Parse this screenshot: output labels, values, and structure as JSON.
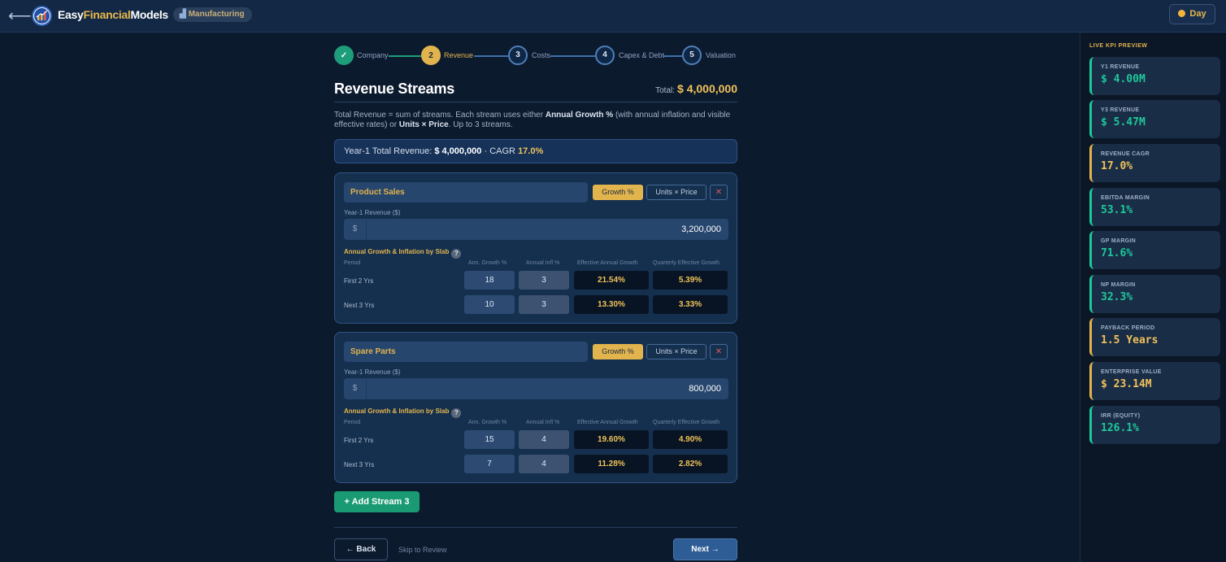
{
  "header": {
    "back_icon": "back-arrow-icon",
    "brand_primary": "Easy",
    "brand_accent": "Financial",
    "brand_suffix": "Models",
    "industry_badge": "Manufacturing",
    "theme_toggle": "Day"
  },
  "stepper": {
    "steps": [
      {
        "number": "✓",
        "label": "Company",
        "state": "done"
      },
      {
        "number": "2",
        "label": "Revenue",
        "state": "active"
      },
      {
        "number": "3",
        "label": "Costs",
        "state": "pending"
      },
      {
        "number": "4",
        "label": "Capex & Debt",
        "state": "pending"
      },
      {
        "number": "5",
        "label": "Valuation",
        "state": "pending"
      }
    ]
  },
  "page": {
    "title": "Revenue Streams",
    "total_label": "Total:",
    "total_value": "$ 4,000,000",
    "description_1": "Total Revenue = sum of streams. Each stream uses either ",
    "description_bold_1": "Annual Growth %",
    "description_2": " (with annual inflation and visible effective rates) or ",
    "description_bold_2": "Units × Price",
    "description_3": ". Up to 3 streams.",
    "summary_prefix": "Year-1 Total Revenue: ",
    "summary_value": "$ 4,000,000",
    "summary_sep": " · CAGR ",
    "summary_cagr": "17.0%"
  },
  "streams": [
    {
      "name": "Product Sales",
      "mode_growth": "Growth %",
      "mode_units": "Units × Price",
      "remove": "✕",
      "revenue_label": "Year-1 Revenue ($)",
      "currency": "$",
      "revenue": "3,200,000",
      "slab_title": "Annual Growth & Inflation by Slab",
      "help": "?",
      "headers": [
        "Period",
        "Ann. Growth %",
        "Annual Infl %",
        "Effective Annual Growth",
        "Quarterly Effective Growth"
      ],
      "rows": [
        {
          "period": "First 2 Yrs",
          "growth": "18",
          "inflation": "3",
          "effective": "21.54%",
          "quarterly": "5.39%"
        },
        {
          "period": "Next 3 Yrs",
          "growth": "10",
          "inflation": "3",
          "effective": "13.30%",
          "quarterly": "3.33%"
        }
      ]
    },
    {
      "name": "Spare Parts",
      "mode_growth": "Growth %",
      "mode_units": "Units × Price",
      "remove": "✕",
      "revenue_label": "Year-1 Revenue ($)",
      "currency": "$",
      "revenue": "800,000",
      "slab_title": "Annual Growth & Inflation by Slab",
      "help": "?",
      "headers": [
        "Period",
        "Ann. Growth %",
        "Annual Infl %",
        "Effective Annual Growth",
        "Quarterly Effective Growth"
      ],
      "rows": [
        {
          "period": "First 2 Yrs",
          "growth": "15",
          "inflation": "4",
          "effective": "19.60%",
          "quarterly": "4.90%"
        },
        {
          "period": "Next 3 Yrs",
          "growth": "7",
          "inflation": "4",
          "effective": "11.28%",
          "quarterly": "2.82%"
        }
      ]
    }
  ],
  "actions": {
    "add_stream": "+ Add Stream 3",
    "back": "← Back",
    "skip": "Skip to Review",
    "next": "Next →"
  },
  "kpi": {
    "heading": "LIVE KPI PREVIEW",
    "cards": [
      {
        "label": "Y1 REVENUE",
        "value": "$ 4.00M",
        "color": "#1ec89a",
        "accent": "#1ec89a"
      },
      {
        "label": "Y3 REVENUE",
        "value": "$ 5.47M",
        "color": "#1ec89a",
        "accent": "#1ec89a"
      },
      {
        "label": "REVENUE CAGR",
        "value": "17.0%",
        "color": "#f0c25a",
        "accent": "#e2b44d"
      },
      {
        "label": "EBITDA MARGIN",
        "value": "53.1%",
        "color": "#1ec89a",
        "accent": "#1ec89a"
      },
      {
        "label": "GP MARGIN",
        "value": "71.6%",
        "color": "#1ec89a",
        "accent": "#1ec89a"
      },
      {
        "label": "NP MARGIN",
        "value": "32.3%",
        "color": "#1ec89a",
        "accent": "#1ec89a"
      },
      {
        "label": "PAYBACK PERIOD",
        "value": "1.5 Years",
        "color": "#f0c25a",
        "accent": "#e2b44d"
      },
      {
        "label": "ENTERPRISE VALUE",
        "value": "$ 23.14M",
        "color": "#f0c25a",
        "accent": "#e2b44d"
      },
      {
        "label": "IRR (EQUITY)",
        "value": "126.1%",
        "color": "#1ec89a",
        "accent": "#1ec89a"
      }
    ]
  }
}
